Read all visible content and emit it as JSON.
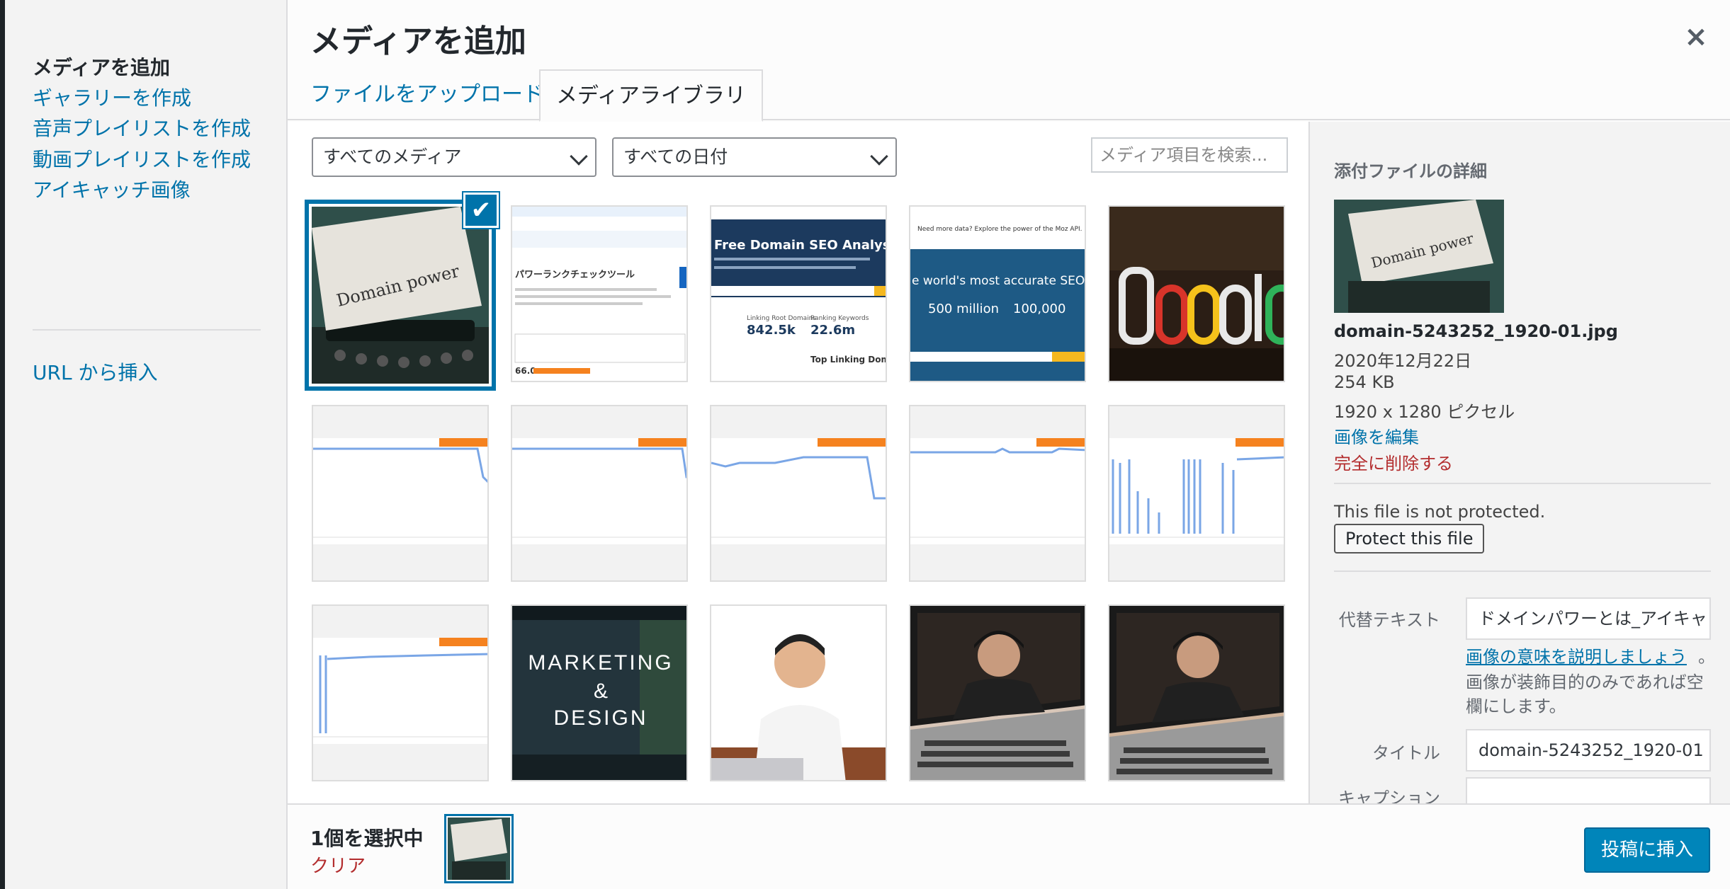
{
  "menu": {
    "items": [
      {
        "label": "メディアを追加",
        "active": true
      },
      {
        "label": "ギャラリーを作成"
      },
      {
        "label": "音声プレイリストを作成"
      },
      {
        "label": "動画プレイリストを作成"
      },
      {
        "label": "アイキャッチ画像"
      },
      {
        "label": "URL から挿入"
      }
    ]
  },
  "frame": {
    "title": "メディアを追加",
    "close_label": "×",
    "tabs": [
      {
        "label": "ファイルをアップロード"
      },
      {
        "label": "メディアライブラリ",
        "active": true
      }
    ]
  },
  "filters": {
    "media_type": "すべてのメディア",
    "date": "すべての日付",
    "search_placeholder": "メディア項目を検索..."
  },
  "thumbs": {
    "t2_title": "パワーランクチェックツール",
    "t2_value": "66.0",
    "t3_title": "Free Domain SEO Analysis Tool",
    "t3_col1": "Linking Root Domains",
    "t3_val1": "842.5k",
    "t3_col2": "Ranking Keywords",
    "t3_val2": "22.6m",
    "t3_sub": "Top Linking Domains",
    "t4_top": "Need more data? Explore the power of the Moz API.",
    "t4_head": "e world's most accurate SEO da",
    "t4_n1": "500 million",
    "t4_n2": "100,000",
    "t1_text": "Domain power",
    "t7_text_1": "MARKETING",
    "t7_text_2": "&",
    "t7_text_3": "DESIGN"
  },
  "details": {
    "heading": "添付ファイルの詳細",
    "filename": "domain-5243252_1920-01.jpg",
    "date": "2020年12月22日",
    "size": "254 KB",
    "dimensions": "1920 x 1280 ピクセル",
    "edit_link": "画像を編集",
    "delete_link": "完全に削除する",
    "protect_status": "This file is not protected.",
    "protect_button": "Protect this file",
    "alt_label": "代替テキスト",
    "alt_value": "ドメインパワーとは_アイキャ",
    "alt_help_link": "画像の意味を説明しましょう",
    "alt_help_end": "。",
    "alt_help_1": "画像が装飾目的のみであれば空",
    "alt_help_2": "欄にします。",
    "title_label": "タイトル",
    "title_value": "domain-5243252_1920-01",
    "caption_label": "キャプション"
  },
  "toolbar": {
    "selected_count": "1個を選択中",
    "clear": "クリア",
    "insert_button": "投稿に挿入"
  },
  "colors": {
    "link": "#0073aa",
    "danger": "#b32d2e",
    "primary_button": "#0085ba",
    "chart_orange": "#f5821f"
  }
}
